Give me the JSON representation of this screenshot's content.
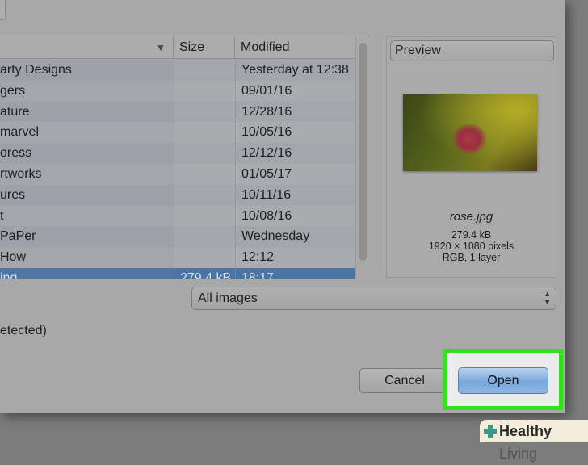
{
  "file_list": {
    "columns": {
      "name_sort_icon": "sort-descending-icon",
      "size": "Size",
      "modified": "Modified"
    },
    "rows": [
      {
        "name": "arty Designs",
        "size": "",
        "modified": "Yesterday at 12:38"
      },
      {
        "name": "gers",
        "size": "",
        "modified": "09/01/16"
      },
      {
        "name": "ature",
        "size": "",
        "modified": "12/28/16"
      },
      {
        "name": " marvel",
        "size": "",
        "modified": "10/05/16"
      },
      {
        "name": "oress",
        "size": "",
        "modified": "12/12/16"
      },
      {
        "name": "rtworks",
        "size": "",
        "modified": "01/05/17"
      },
      {
        "name": "ures",
        "size": "",
        "modified": "10/11/16"
      },
      {
        "name": "t",
        "size": "",
        "modified": "10/08/16"
      },
      {
        "name": "PaPer",
        "size": "",
        "modified": "Wednesday"
      },
      {
        "name": "How",
        "size": "",
        "modified": "12:12"
      },
      {
        "name": "ing",
        "size": "279.4 kB",
        "modified": "18:17",
        "selected": true
      }
    ]
  },
  "preview": {
    "label": "Preview",
    "file_name": "rose.jpg",
    "file_size": "279.4 kB",
    "dimensions": "1920 × 1080 pixels",
    "color_info": "RGB, 1 layer"
  },
  "file_type": {
    "selected": "All images",
    "arrows": "▲▼"
  },
  "detect_label": "etected)",
  "buttons": {
    "cancel": "Cancel",
    "open": "Open"
  },
  "highlight_color": "#33e01c",
  "watermark": {
    "brand": "Healthy",
    "suffix": "Living"
  }
}
